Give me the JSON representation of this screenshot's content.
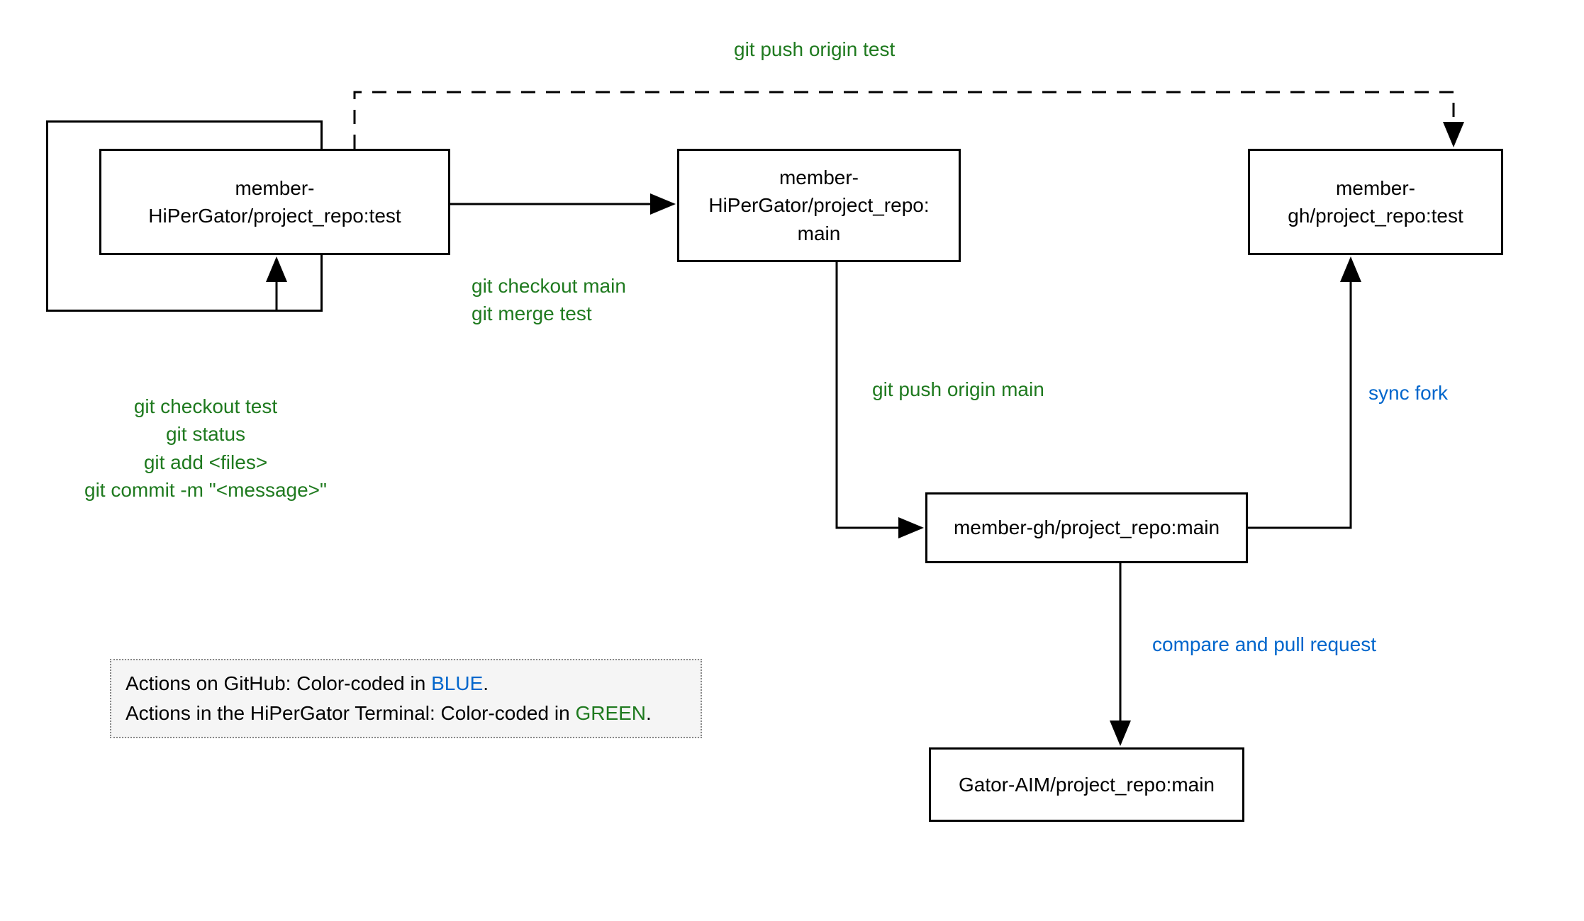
{
  "nodes": {
    "box1_back": "",
    "box1": "member-\nHiPerGator/project_repo:test",
    "box2": "member-\nHiPerGator/project_repo:\nmain",
    "box3": "member-\ngh/project_repo:test",
    "box4": "member-gh/project_repo:main",
    "box5": "Gator-AIM/project_repo:main"
  },
  "labels": {
    "push_test": "git push origin test",
    "checkout_merge": "git checkout main\ngit merge test",
    "checkout_status": "git checkout test\ngit status\ngit add <files>\ngit commit  -m \"<message>\"",
    "push_main": "git push origin main",
    "sync_fork": "sync fork",
    "compare_pr": "compare and pull request"
  },
  "legend": {
    "line1_prefix": "Actions on GitHub: Color-coded in ",
    "line1_color": "BLUE",
    "line1_suffix": ".",
    "line2_prefix": "Actions in the HiPerGator Terminal: Color-coded in ",
    "line2_color": "GREEN",
    "line2_suffix": "."
  },
  "colors": {
    "green": "#1f7a1f",
    "blue": "#0066cc",
    "black": "#000000"
  }
}
